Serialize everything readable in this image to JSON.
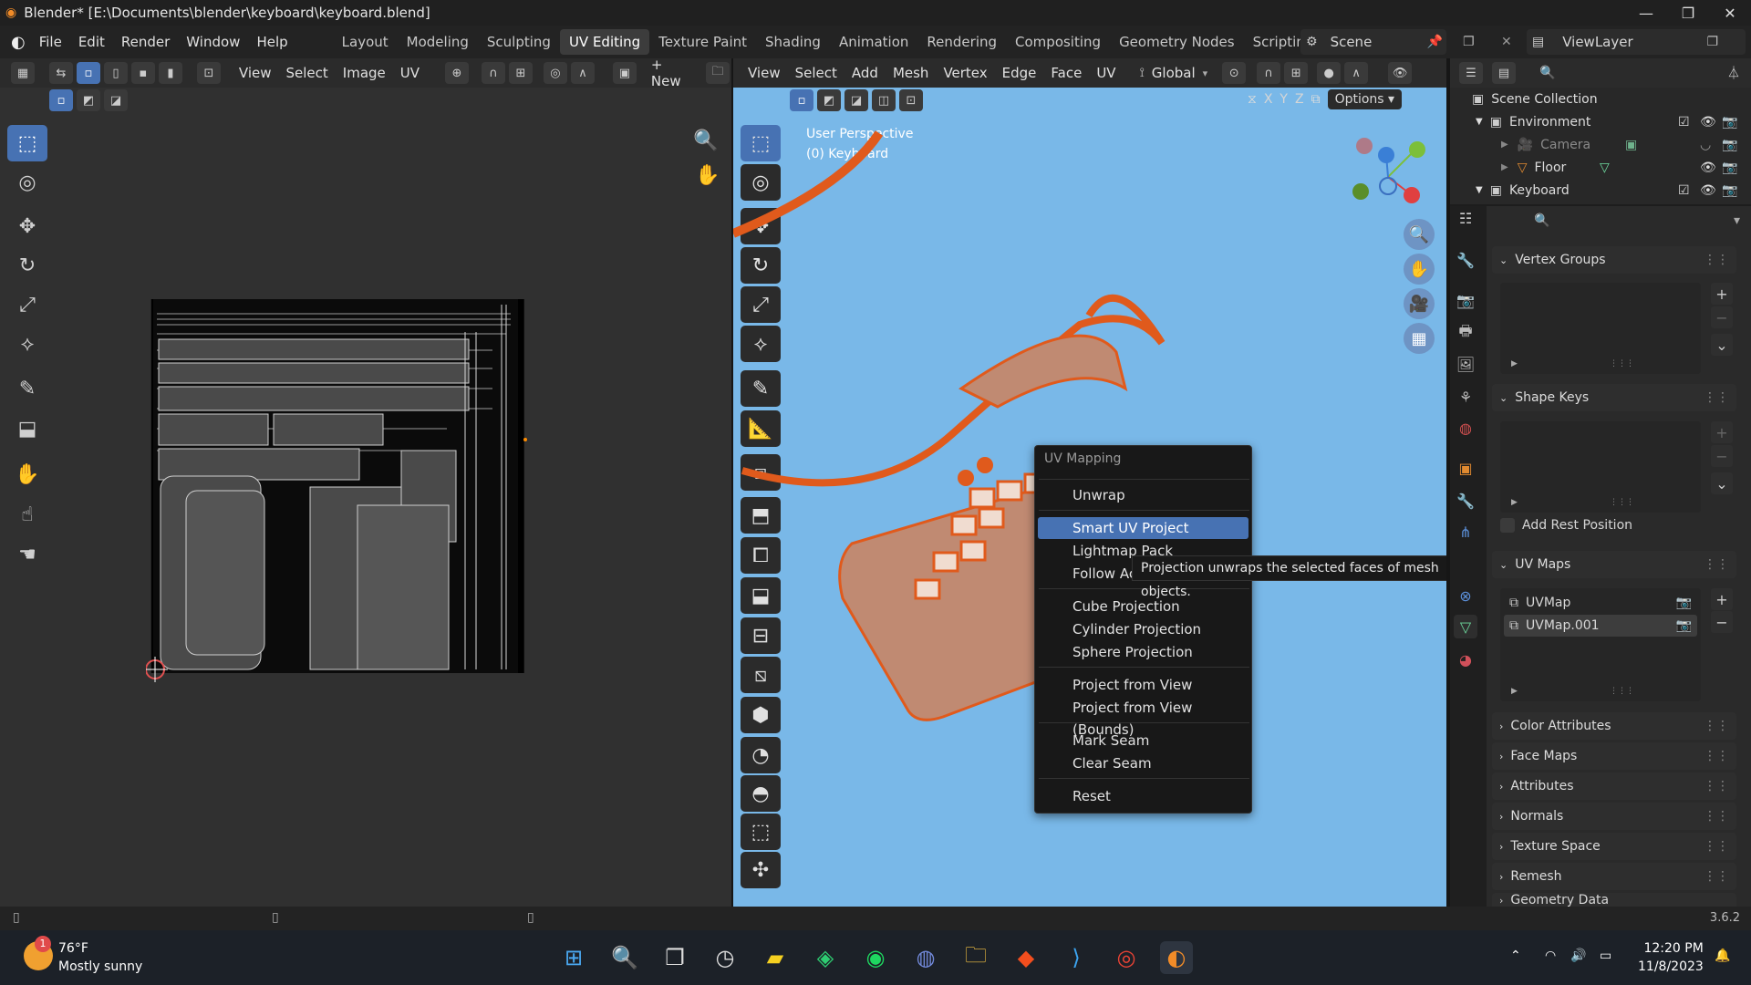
{
  "window": {
    "title": "Blender* [E:\\Documents\\blender\\keyboard\\keyboard.blend]"
  },
  "menubar": {
    "items": [
      "File",
      "Edit",
      "Render",
      "Window",
      "Help"
    ],
    "workspaces": [
      "Layout",
      "Modeling",
      "Sculpting",
      "UV Editing",
      "Texture Paint",
      "Shading",
      "Animation",
      "Rendering",
      "Compositing",
      "Geometry Nodes",
      "Scripting"
    ],
    "active_workspace": "UV Editing",
    "add": "+",
    "scene": "Scene",
    "view_layer": "ViewLayer"
  },
  "uv_editor": {
    "header": {
      "view": "View",
      "select": "Select",
      "image": "Image",
      "uv": "UV",
      "new": "New"
    }
  },
  "viewport": {
    "header": {
      "view": "View",
      "select": "Select",
      "add": "Add",
      "mesh": "Mesh",
      "vertex": "Vertex",
      "edge": "Edge",
      "face": "Face",
      "uv": "UV",
      "orientation": "Global",
      "options": "Options"
    },
    "axes": [
      "X",
      "Y",
      "Z"
    ],
    "info": {
      "perspective": "User Perspective",
      "object": "(0) Keyboard"
    }
  },
  "uv_menu": {
    "title": "UV Mapping",
    "items": {
      "unwrap": "Unwrap",
      "smart": "Smart UV Project",
      "lightmap": "Lightmap Pack",
      "follow": "Follow Ac",
      "cube": "Cube Projection",
      "cylinder": "Cylinder Projection",
      "sphere": "Sphere Projection",
      "project_view": "Project from View",
      "project_bounds": "Project from View (Bounds)",
      "mark_seam": "Mark Seam",
      "clear_seam": "Clear Seam",
      "reset": "Reset"
    },
    "tooltip": "Projection unwraps the selected faces of mesh objects."
  },
  "outliner": {
    "scene_collection": "Scene Collection",
    "rows": [
      {
        "label": "Environment"
      },
      {
        "label": "Camera"
      },
      {
        "label": "Floor"
      },
      {
        "label": "Keyboard"
      }
    ]
  },
  "properties": {
    "vertex_groups": "Vertex Groups",
    "shape_keys": "Shape Keys",
    "add_rest_position": "Add Rest Position",
    "uv_maps": "UV Maps",
    "uvmaps": [
      "UVMap",
      "UVMap.001"
    ],
    "sections": [
      "Color Attributes",
      "Face Maps",
      "Attributes",
      "Normals",
      "Texture Space",
      "Remesh",
      "Geometry Data"
    ]
  },
  "status": {
    "version": "3.6.2"
  },
  "taskbar": {
    "weather_temp": "76°F",
    "weather_desc": "Mostly sunny",
    "badge": "1",
    "time": "12:20 PM",
    "date": "11/8/2023"
  }
}
